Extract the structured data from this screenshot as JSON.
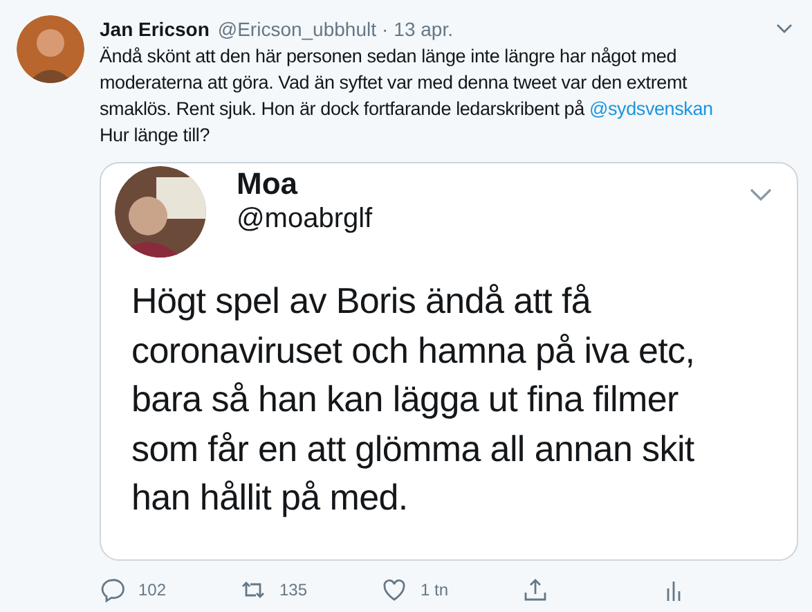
{
  "tweet": {
    "name": "Jan Ericson",
    "handle": "@Ericson_ubbhult",
    "separator": "·",
    "date": "13 apr.",
    "text": "Ändå skönt att den här personen sedan länge inte längre har något med moderaterna att göra. Vad än syftet var med denna tweet var den extremt smaklös. Rent sjuk. Hon är dock fortfarande ledarskribent på",
    "mention": "@sydsvenskan",
    "text_end": "Hur länge till?"
  },
  "quoted": {
    "name": "Moa",
    "handle": "@moabrglf",
    "text": "Högt spel av Boris ändå att få coronaviruset och hamna på iva etc, bara så han kan lägga ut fina filmer som får en att glömma all annan skit han hållit på med."
  },
  "actions": [
    {
      "kind": "reply",
      "count": "102"
    },
    {
      "kind": "retweet",
      "count": "135"
    },
    {
      "kind": "like",
      "count": "1 tn"
    },
    {
      "kind": "share"
    },
    {
      "kind": "stats"
    }
  ]
}
